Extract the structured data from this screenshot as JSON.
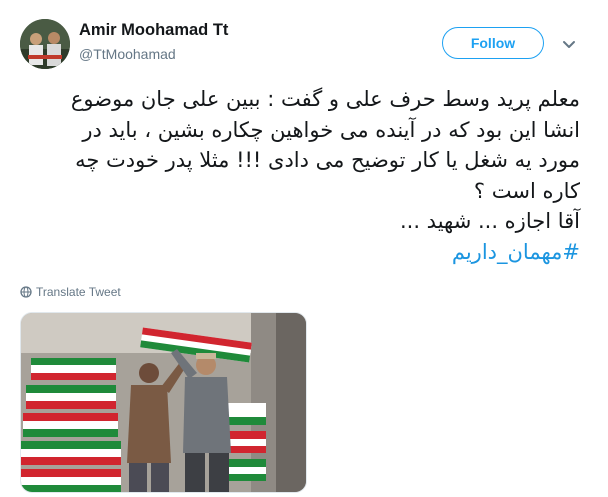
{
  "tweet": {
    "author": {
      "display_name": "Amir Moohamad Tt",
      "handle": "@TtMoohamad",
      "avatar_icon": "user-avatar-photo"
    },
    "follow_label": "Follow",
    "menu_icon": "chevron-down-icon",
    "text_lines": [
      "معلم پرید وسط حرف علی و گفت : ببین علی جان موضوع",
      "انشا این بود که در آینده می خواهین چکاره بشین ، باید در",
      "مورد یه شغل یا کار توضیح می دادی !!! مثلا پدر خودت چه",
      "کاره است ؟",
      "آقا اجازه ... شهید ..."
    ],
    "hashtag": "#مهمان_داریم",
    "translate_label": "Translate Tweet",
    "translate_icon": "globe-icon",
    "media_alt_icon": "photo-flag-draped-coffins"
  },
  "colors": {
    "accent": "#1da1f2",
    "hashtag": "#1b95e0",
    "secondary_text": "#657786"
  }
}
